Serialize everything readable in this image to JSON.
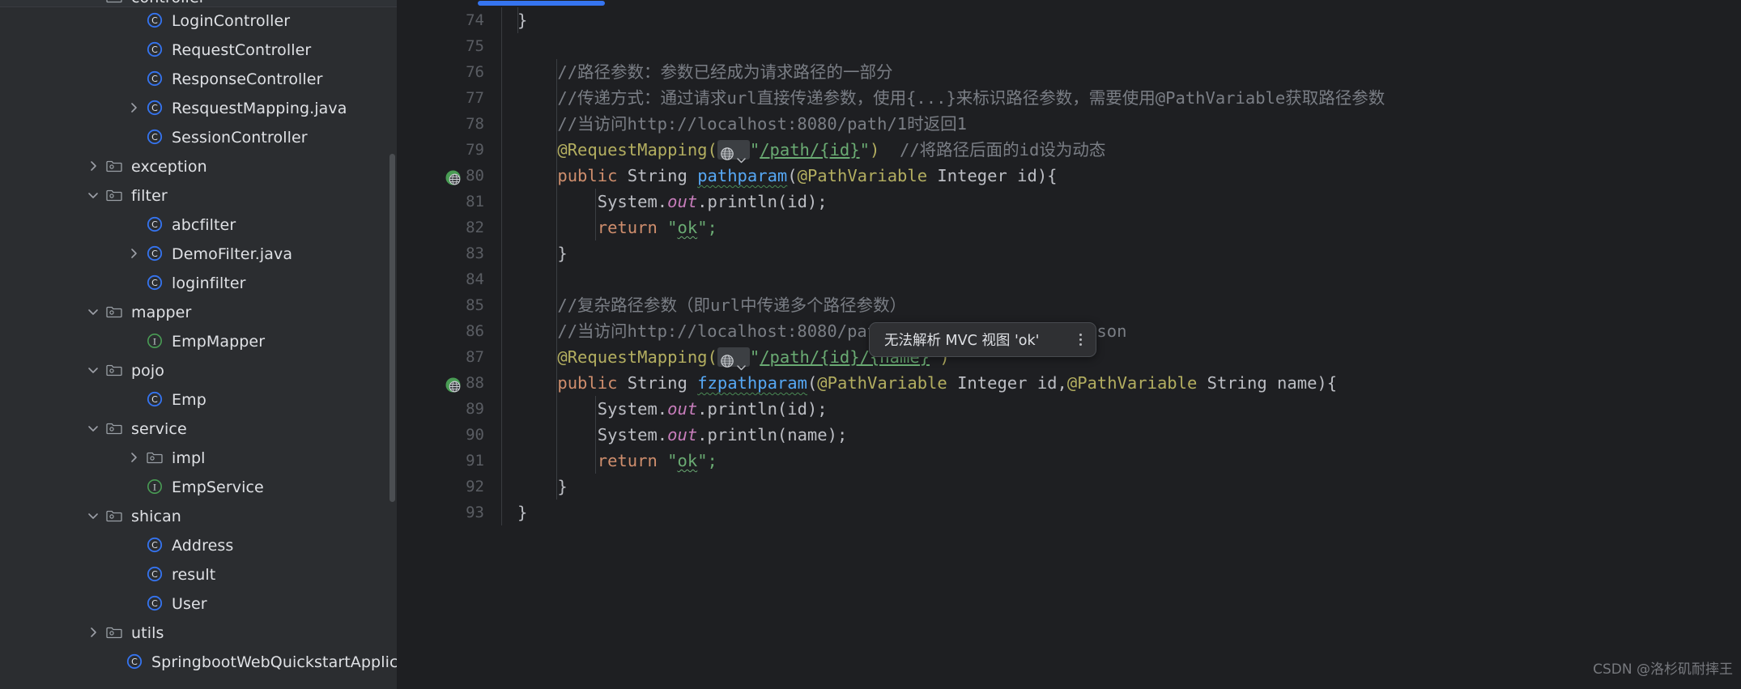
{
  "sidebar": {
    "scrollbar": "vertical-scrollbar",
    "tree": [
      {
        "label": "controller",
        "icon": "folder-icon",
        "indent": 130,
        "chevron": "down",
        "clipped": true
      },
      {
        "label": "LoginController",
        "icon": "class-icon",
        "indent": 180,
        "chevron": "none"
      },
      {
        "label": "RequestController",
        "icon": "class-icon",
        "indent": 180,
        "chevron": "none"
      },
      {
        "label": "ResponseController",
        "icon": "class-icon",
        "indent": 180,
        "chevron": "none"
      },
      {
        "label": "ResquestMapping.java",
        "icon": "class-icon",
        "indent": 180,
        "chevron": "right"
      },
      {
        "label": "SessionController",
        "icon": "class-icon",
        "indent": 180,
        "chevron": "none"
      },
      {
        "label": "exception",
        "icon": "folder-icon",
        "indent": 130,
        "chevron": "right"
      },
      {
        "label": "filter",
        "icon": "folder-icon",
        "indent": 130,
        "chevron": "down"
      },
      {
        "label": "abcfilter",
        "icon": "class-icon",
        "indent": 180,
        "chevron": "none"
      },
      {
        "label": "DemoFilter.java",
        "icon": "class-icon",
        "indent": 180,
        "chevron": "right"
      },
      {
        "label": "loginfilter",
        "icon": "class-icon",
        "indent": 180,
        "chevron": "none"
      },
      {
        "label": "mapper",
        "icon": "folder-icon",
        "indent": 130,
        "chevron": "down"
      },
      {
        "label": "EmpMapper",
        "icon": "interface-icon",
        "indent": 180,
        "chevron": "none"
      },
      {
        "label": "pojo",
        "icon": "folder-icon",
        "indent": 130,
        "chevron": "down"
      },
      {
        "label": "Emp",
        "icon": "class-icon",
        "indent": 180,
        "chevron": "none"
      },
      {
        "label": "service",
        "icon": "folder-icon",
        "indent": 130,
        "chevron": "down"
      },
      {
        "label": "impl",
        "icon": "folder-icon",
        "indent": 180,
        "chevron": "right"
      },
      {
        "label": "EmpService",
        "icon": "interface-icon",
        "indent": 180,
        "chevron": "none"
      },
      {
        "label": "shican",
        "icon": "folder-icon",
        "indent": 130,
        "chevron": "down"
      },
      {
        "label": "Address",
        "icon": "class-icon",
        "indent": 180,
        "chevron": "none"
      },
      {
        "label": "result",
        "icon": "class-icon",
        "indent": 180,
        "chevron": "none"
      },
      {
        "label": "User",
        "icon": "class-icon",
        "indent": 180,
        "chevron": "none"
      },
      {
        "label": "utils",
        "icon": "folder-icon",
        "indent": 130,
        "chevron": "right"
      },
      {
        "label": "SpringbootWebQuickstartApplication",
        "icon": "class-icon",
        "indent": 155,
        "chevron": "none"
      }
    ]
  },
  "editor": {
    "progress": {
      "name": "loading-progress-bar"
    },
    "lines": [
      {
        "num": "74",
        "gutter_icon": null,
        "indents": [
          0
        ],
        "tokens": [
          {
            "t": "}",
            "c": "id",
            "x": 0
          }
        ]
      },
      {
        "num": "75",
        "gutter_icon": null,
        "indents": [],
        "tokens": []
      },
      {
        "num": "76",
        "gutter_icon": null,
        "indents": [
          48
        ],
        "tokens": [
          {
            "t": "    //路径参数：参数已经成为请求路径的一部分",
            "c": "cmt",
            "x": 0
          }
        ]
      },
      {
        "num": "77",
        "gutter_icon": null,
        "indents": [
          48
        ],
        "tokens": [
          {
            "t": "    //传递方式：通过请求url直接传递参数，使用{...}来标识路径参数，需要使用@PathVariable获取路径参数",
            "c": "cmt",
            "x": 0
          }
        ]
      },
      {
        "num": "78",
        "gutter_icon": null,
        "indents": [
          48
        ],
        "tokens": [
          {
            "t": "    //当访问http://localhost:8080/path/1时返回1",
            "c": "cmt",
            "x": 0
          }
        ]
      },
      {
        "num": "79",
        "gutter_icon": null,
        "indents": [
          48
        ],
        "tokens": [
          {
            "t": "    @RequestMapping(",
            "c": "ann",
            "x": 0
          },
          {
            "t": "globe-chip",
            "c": "chip",
            "x": 0
          },
          {
            "t": "\"",
            "c": "str",
            "x": 0
          },
          {
            "t": "/path/{id}",
            "c": "ulink",
            "x": 0
          },
          {
            "t": "\"",
            "c": "str",
            "x": 0
          },
          {
            "t": ")",
            "c": "ann",
            "x": 0
          },
          {
            "t": "  //将路径后面的id设为动态",
            "c": "cmt",
            "x": 0
          }
        ]
      },
      {
        "num": "80",
        "gutter_icon": "web-endpoint-icon",
        "indents": [
          48
        ],
        "tokens": [
          {
            "t": "    ",
            "c": "id",
            "x": 0
          },
          {
            "t": "public",
            "c": "kw",
            "x": 0
          },
          {
            "t": " String ",
            "c": "typ",
            "x": 0
          },
          {
            "t": "pathparam",
            "c": "fn-wavy",
            "x": 0
          },
          {
            "t": "(",
            "c": "id",
            "x": 0
          },
          {
            "t": "@PathVariable",
            "c": "ann",
            "x": 0
          },
          {
            "t": " Integer id){",
            "c": "typ",
            "x": 0
          }
        ]
      },
      {
        "num": "81",
        "gutter_icon": null,
        "indents": [
          48,
          96
        ],
        "tokens": [
          {
            "t": "        System.",
            "c": "typ",
            "x": 0
          },
          {
            "t": "out",
            "c": "fld",
            "x": 0
          },
          {
            "t": ".println(id);",
            "c": "typ",
            "x": 0
          }
        ]
      },
      {
        "num": "82",
        "gutter_icon": null,
        "indents": [
          48,
          96
        ],
        "tokens": [
          {
            "t": "        ",
            "c": "typ",
            "x": 0
          },
          {
            "t": "return",
            "c": "kw",
            "x": 0
          },
          {
            "t": " ",
            "c": "typ",
            "x": 0
          },
          {
            "t": "\"",
            "c": "str",
            "x": 0
          },
          {
            "t": "ok",
            "c": "str-wavy",
            "x": 0
          },
          {
            "t": "\";",
            "c": "str",
            "x": 0
          }
        ]
      },
      {
        "num": "83",
        "gutter_icon": null,
        "indents": [
          48
        ],
        "tokens": [
          {
            "t": "    }",
            "c": "id",
            "x": 0
          }
        ]
      },
      {
        "num": "84",
        "gutter_icon": null,
        "indents": [
          48
        ],
        "tokens": []
      },
      {
        "num": "85",
        "gutter_icon": null,
        "indents": [
          48
        ],
        "tokens": [
          {
            "t": "    //复杂路径参数（即url中传递多个路径参数）",
            "c": "cmt",
            "x": 0
          }
        ]
      },
      {
        "num": "86",
        "gutter_icon": null,
        "indents": [
          48
        ],
        "tokens": [
          {
            "t": "    //当访问http://localhost:8080/path/1/iverson时返回1 iverson",
            "c": "cmt",
            "x": 0
          }
        ]
      },
      {
        "num": "87",
        "gutter_icon": null,
        "indents": [
          48
        ],
        "tokens": [
          {
            "t": "    @RequestMapping(",
            "c": "ann",
            "x": 0
          },
          {
            "t": "globe-chip",
            "c": "chip",
            "x": 0
          },
          {
            "t": "\"",
            "c": "str",
            "x": 0
          },
          {
            "t": "/path/{id}/{name}",
            "c": "ulink",
            "x": 0
          },
          {
            "t": "\"",
            "c": "str",
            "x": 0
          },
          {
            "t": ")",
            "c": "ann",
            "x": 0
          }
        ]
      },
      {
        "num": "88",
        "gutter_icon": "web-endpoint-icon",
        "indents": [
          48
        ],
        "tokens": [
          {
            "t": "    ",
            "c": "id",
            "x": 0
          },
          {
            "t": "public",
            "c": "kw",
            "x": 0
          },
          {
            "t": " String ",
            "c": "typ",
            "x": 0
          },
          {
            "t": "fzpathparam",
            "c": "fn-wavy",
            "x": 0
          },
          {
            "t": "(",
            "c": "id",
            "x": 0
          },
          {
            "t": "@PathVariable",
            "c": "ann",
            "x": 0
          },
          {
            "t": " Integer id,",
            "c": "typ",
            "x": 0
          },
          {
            "t": "@PathVariable",
            "c": "ann",
            "x": 0
          },
          {
            "t": " String name){",
            "c": "typ",
            "x": 0
          }
        ]
      },
      {
        "num": "89",
        "gutter_icon": null,
        "indents": [
          48,
          96
        ],
        "tokens": [
          {
            "t": "        System.",
            "c": "typ",
            "x": 0
          },
          {
            "t": "out",
            "c": "fld",
            "x": 0
          },
          {
            "t": ".println(id);",
            "c": "typ",
            "x": 0
          }
        ]
      },
      {
        "num": "90",
        "gutter_icon": null,
        "indents": [
          48,
          96
        ],
        "tokens": [
          {
            "t": "        System.",
            "c": "typ",
            "x": 0
          },
          {
            "t": "out",
            "c": "fld",
            "x": 0
          },
          {
            "t": ".println(name);",
            "c": "typ",
            "x": 0
          }
        ]
      },
      {
        "num": "91",
        "gutter_icon": null,
        "indents": [
          48,
          96
        ],
        "tokens": [
          {
            "t": "        ",
            "c": "typ",
            "x": 0
          },
          {
            "t": "return",
            "c": "kw",
            "x": 0
          },
          {
            "t": " ",
            "c": "typ",
            "x": 0
          },
          {
            "t": "\"",
            "c": "str",
            "x": 0
          },
          {
            "t": "ok",
            "c": "str-wavy",
            "x": 0
          },
          {
            "t": "\";",
            "c": "str",
            "x": 0
          }
        ]
      },
      {
        "num": "92",
        "gutter_icon": null,
        "indents": [
          48
        ],
        "tokens": [
          {
            "t": "    }",
            "c": "id",
            "x": 0
          }
        ]
      },
      {
        "num": "93",
        "gutter_icon": null,
        "indents": [],
        "tokens": [
          {
            "t": "}",
            "c": "id",
            "x": 0
          }
        ]
      }
    ]
  },
  "tooltip": {
    "text": "无法解析 MVC 视图 'ok'",
    "more_icon": "more-vertical-icon"
  },
  "watermark": {
    "text": "CSDN @洛杉矶耐摔王"
  },
  "colors": {
    "accent": "#3574f0",
    "editor_bg": "#1e1f22",
    "sidebar_bg": "#2b2d30",
    "comment": "#7a7e85",
    "string": "#6aab73",
    "keyword": "#cf8e6d",
    "annotation": "#b3ae60",
    "method": "#56a8f5"
  }
}
